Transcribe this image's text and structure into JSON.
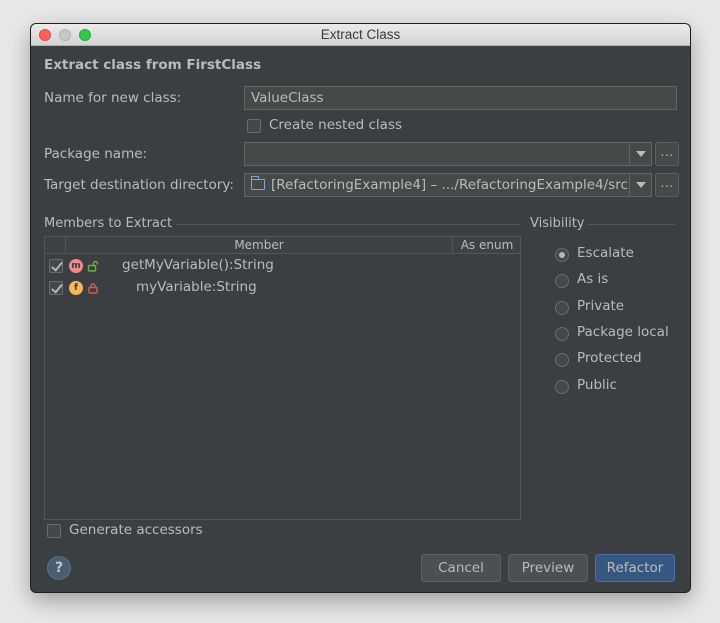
{
  "window": {
    "title": "Extract Class"
  },
  "heading": "Extract class from FirstClass",
  "name_field": {
    "label": "Name for new class:",
    "value": "ValueClass"
  },
  "nested_class": {
    "label": "Create nested class",
    "checked": false
  },
  "package": {
    "label": "Package name:",
    "value": "",
    "dots": "..."
  },
  "target": {
    "label": "Target destination directory:",
    "value": "[RefactoringExample4] – .../RefactoringExample4/src",
    "dots": "..."
  },
  "members": {
    "title": "Members to Extract",
    "columns": {
      "member": "Member",
      "as_enum": "As enum"
    },
    "rows": [
      {
        "checked": true,
        "icon": "m",
        "lock": "unlocked",
        "text": "getMyVariable():String"
      },
      {
        "checked": true,
        "icon": "f",
        "lock": "locked",
        "text": "myVariable:String"
      }
    ]
  },
  "visibility": {
    "title": "Visibility",
    "options": [
      {
        "label": "Escalate",
        "selected": true
      },
      {
        "label": "As is",
        "selected": false
      },
      {
        "label": "Private",
        "selected": false
      },
      {
        "label": "Package local",
        "selected": false
      },
      {
        "label": "Protected",
        "selected": false
      },
      {
        "label": "Public",
        "selected": false
      }
    ]
  },
  "generate_accessors": {
    "label": "Generate accessors",
    "checked": false
  },
  "buttons": {
    "help": "?",
    "cancel": "Cancel",
    "preview": "Preview",
    "refactor": "Refactor"
  },
  "colors": {
    "background": "#3c3f41",
    "accent": "#365880",
    "text": "#bbbbbb"
  }
}
